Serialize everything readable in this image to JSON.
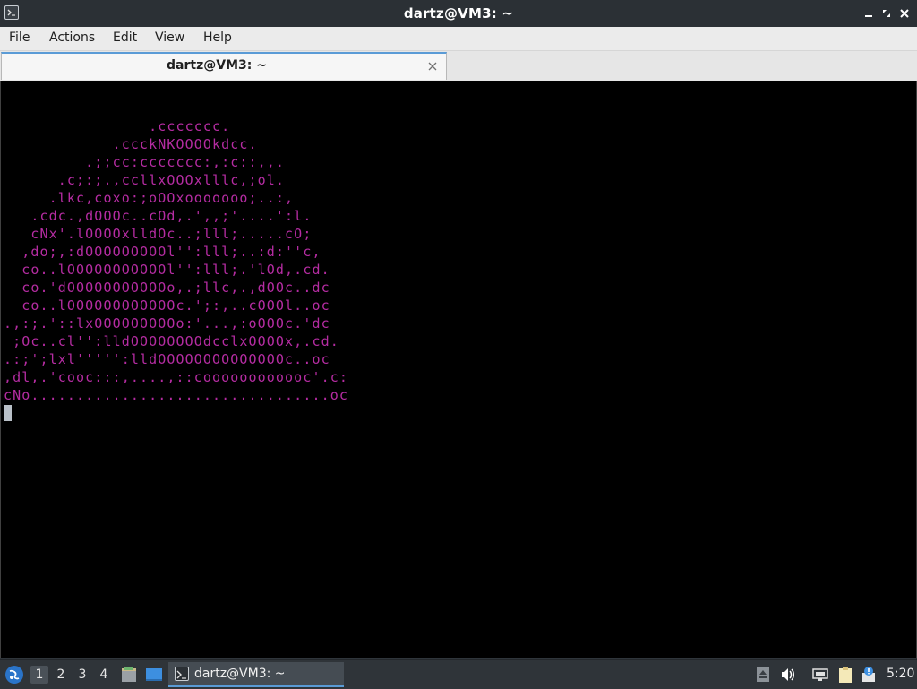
{
  "window": {
    "title": "dartz@VM3: ~"
  },
  "menu": {
    "items": [
      "File",
      "Actions",
      "Edit",
      "View",
      "Help"
    ]
  },
  "tabs": [
    {
      "label": "dartz@VM3: ~"
    }
  ],
  "terminal": {
    "output": "                .ccccccc.\n            .ccckNKOOOOkdcc.\n         .;;cc:ccccccc:,:c::,,.\n      .c;:;.,ccllxOOOxlllc,;ol.\n     .lkc,coxo:;oOOxooooooo;..:,\n   .cdc.,dOOOc..cOd,.',,;'....':l.\n   cNx'.lOOOOxlldOc..;lll;.....cO;\n  ,do;,:dOOOOOOOOOl'':lll;..:d:''c,\n  co..lOOOOOOOOOOOl'':lll;.'lOd,.cd.\n  co.'dOOOOOOOOOOOo,.;llc,.,dOOc..dc\n  co..lOOOOOOOOOOOOc.';:,..cOOOl..oc\n.,:;.'::lxOOOOOOOOOo:'...,:oOOOc.'dc\n ;Oc..cl'':lldOOOOOOOOdcclxOOOOx,.cd.\n.:;';lxl''''':lldOOOOOOOOOOOOOOc..oc\n,dl,.'cooc:::,....,::coooooooooooc'.c:\ncNo.................................oc",
    "text_color": "#b52ca2",
    "background": "#000000"
  },
  "taskbar": {
    "workspaces": [
      "1",
      "2",
      "3",
      "4"
    ],
    "active_workspace": "1",
    "task_label": "dartz@VM3: ~",
    "clock": "5:20",
    "icons": [
      "start-menu-icon",
      "file-manager-icon",
      "desktop-icon",
      "terminal-icon",
      "updates-icon",
      "volume-icon",
      "network-icon",
      "clipboard-icon",
      "notification-icon"
    ]
  }
}
